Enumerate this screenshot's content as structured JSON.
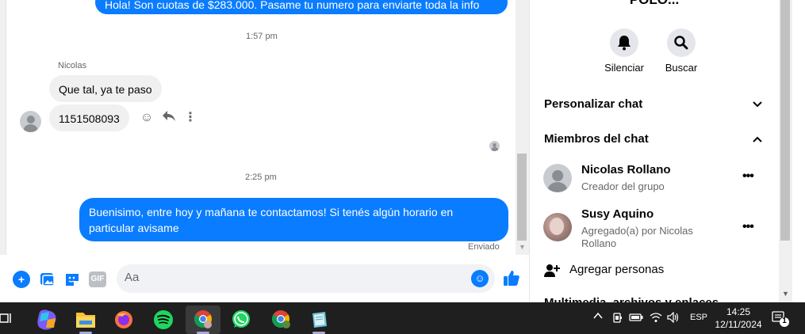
{
  "chat": {
    "messages": {
      "top_out": "Hola! Son cuotas de $283.000. Pasame tu numero para enviarte toda la info",
      "time1": "1:57 pm",
      "sender": "Nicolas",
      "in1": "Que tal, ya te paso",
      "in2": "1151508093",
      "time2": "2:25 pm",
      "out2": "Buenisimo, entre hoy y mañana te contactamos! Si tenés algún horario en particular avisame",
      "status": "Enviado"
    },
    "composer": {
      "placeholder": "Aa",
      "gif_label": "GIF"
    }
  },
  "side": {
    "title": "POLO...",
    "actions": {
      "mute_label": "Silenciar",
      "search_label": "Buscar"
    },
    "sections": {
      "customize": "Personalizar chat",
      "members": "Miembros del chat",
      "media_cut": "Multimedia, archivos y enlaces"
    },
    "members": [
      {
        "name": "Nicolas Rollano",
        "sub": "Creador del grupo"
      },
      {
        "name": "Susy Aquino",
        "sub": "Agregado(a) por Nicolas Rollano"
      }
    ],
    "add_people": "Agregar personas"
  },
  "taskbar": {
    "lang": "ESP",
    "time": "14:25",
    "date": "12/11/2024",
    "notif_count": "1"
  },
  "colors": {
    "accent": "#0a7cff",
    "bubble_in": "#f0f0f0",
    "taskbar": "#1f1f1f"
  }
}
